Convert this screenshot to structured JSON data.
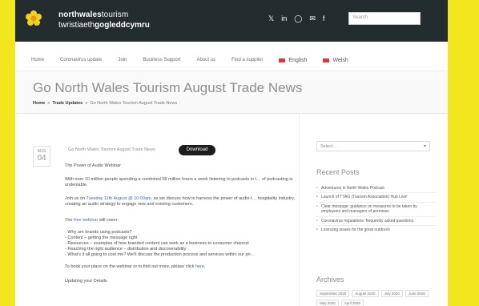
{
  "header": {
    "brand_bold": "northwales",
    "brand_rest": "tourism",
    "brand_welsh_prefix": "twristiaeth",
    "brand_welsh_bold": "gogleddcymru",
    "search_placeholder": "Search",
    "social_icons": [
      "twitter-icon",
      "linkedin-icon",
      "instagram-icon",
      "email-icon",
      "facebook-icon"
    ],
    "brand_color": "#f2e61e",
    "bar_color": "#232d2f"
  },
  "nav": {
    "items": [
      "Home",
      "Coronavirus update",
      "Join",
      "Business Support",
      "About us",
      "Find a supplier"
    ],
    "lang_en": "English",
    "lang_cy": "Welsh"
  },
  "page": {
    "title": "Go North Wales Tourism August Trade News",
    "breadcrumb_home": "Home",
    "breadcrumb_sep": "»",
    "breadcrumb_section": "Trade Updates",
    "breadcrumb_current": "Go North Wales Tourism August Trade News"
  },
  "post": {
    "month": "AUG",
    "day": "04",
    "title": "Go North Wales Tourism August Trade News",
    "download_label": "Download",
    "intro_heading": "The Power of Audio Webinar",
    "para1": "With over 10 million people spending a combined 58 million hours a week listening to podcasts in t… of podcasting is undeniable.",
    "para2_lead": "Join us on",
    "para2_link": "Tuesday 11th August @ 10:00am,",
    "para2_rest": " as we discuss how to harness the power of audio t… hospitality industry, creating an audio strategy to engage new and existing customers.",
    "webinar_lead": "The",
    "webinar_link": "free webinar",
    "webinar_rest": " will cover:",
    "bullets": [
      "- Why are brands using podcasts?",
      "- Content – getting the message right",
      "- Resources – examples of how branded content can work as a business to consumer channel",
      "- Reaching the right audience – distribution and discoverability",
      "- What's it all going to cost me? We'll discuss the production process and services within our pri…"
    ],
    "book_text": "To book your place on the webinar or to find out more, please click",
    "book_link": "here",
    "updating": "Updating your Details"
  },
  "sidebar": {
    "archive_select": "Select…",
    "recent_heading": "Recent Posts",
    "recent_posts": [
      "Adventures in North Wales Podcast",
      "Launch of TTAG (Tourism Association) Hub Live!",
      "Clear message: guidance on measures to be taken by employees and managers of premises",
      "Coronavirus regulations: frequently asked questions",
      "Licensing issues for the great outdoors"
    ],
    "archives_heading": "Archives",
    "archive_months": [
      "September 2020",
      "August 2020",
      "July 2020",
      "June 2020",
      "May 2020",
      "April 2020"
    ]
  }
}
